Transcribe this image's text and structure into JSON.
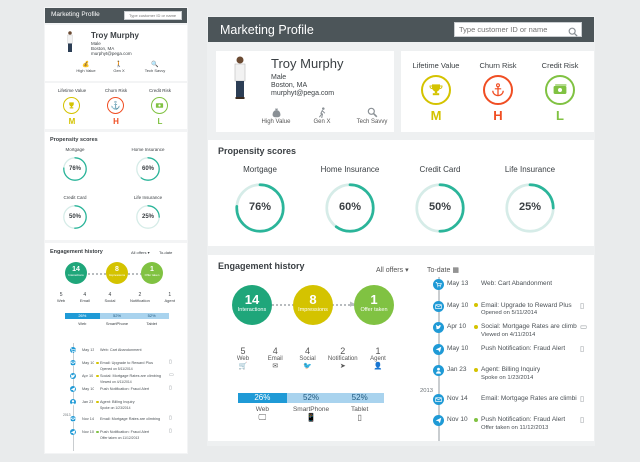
{
  "app": {
    "title": "Marketing Profile",
    "search_placeholder": "Type customer ID or name",
    "search_placeholder_small": "Type customer ID or name"
  },
  "customer": {
    "name": "Troy Murphy",
    "gender": "Male",
    "city": "Boston, MA",
    "email": "murphyt@pega.com"
  },
  "traits": [
    {
      "label": "High Value",
      "icon": "money-bag-icon"
    },
    {
      "label": "Gen X",
      "icon": "walking-person-icon"
    },
    {
      "label": "Tech Savvy",
      "icon": "magnifier-icon"
    }
  ],
  "risks": [
    {
      "label": "Lifetime Value",
      "value": "M",
      "icon": "trophy-icon",
      "color": "#d4c300"
    },
    {
      "label": "Churn Risk",
      "value": "H",
      "icon": "anchor-icon",
      "color": "#f04e23"
    },
    {
      "label": "Credit Risk",
      "value": "L",
      "icon": "cash-icon",
      "color": "#80c242"
    }
  ],
  "propensity": {
    "title": "Propensity scores",
    "items": [
      {
        "label": "Mortgage",
        "value": "76%",
        "fraction": 0.76
      },
      {
        "label": "Home Insurance",
        "value": "60%",
        "fraction": 0.6
      },
      {
        "label": "Credit Card",
        "value": "50%",
        "fraction": 0.5
      },
      {
        "label": "Life Insurance",
        "value": "25%",
        "fraction": 0.25
      }
    ]
  },
  "engagement": {
    "title": "Engagement history",
    "filter": "All offers",
    "to_date": "To-date",
    "funnel": [
      {
        "count": "14",
        "label": "Interactions",
        "color": "#1fa67a"
      },
      {
        "count": "8",
        "label": "Impressions",
        "color": "#d4c300"
      },
      {
        "count": "1",
        "label": "Offer taken",
        "color": "#80c242"
      }
    ],
    "channels": [
      {
        "count": "5",
        "label": "Web",
        "icon": "cart-icon"
      },
      {
        "count": "4",
        "label": "Email",
        "icon": "envelope-icon"
      },
      {
        "count": "4",
        "label": "Social",
        "icon": "twitter-icon"
      },
      {
        "count": "2",
        "label": "Notification",
        "icon": "paper-plane-icon"
      },
      {
        "count": "1",
        "label": "Agent",
        "icon": "person-icon"
      }
    ],
    "devices": [
      {
        "pct": "26%",
        "label": "Web",
        "fraction": 0.26,
        "icon": "monitor-icon"
      },
      {
        "pct": "52%",
        "label": "SmartPhone",
        "fraction": 0.52,
        "icon": "phone-icon"
      },
      {
        "pct": "52%",
        "label": "Tablet",
        "fraction": 0.52,
        "icon": "tablet-icon"
      }
    ],
    "timeline": [
      {
        "date": "May 13",
        "text": "Web: Cart Abandonment",
        "sub": "",
        "icon": "cart-icon",
        "status": "",
        "device": ""
      },
      {
        "date": "May 10",
        "text": "Email: Upgrade to Reward Plus",
        "sub": "Opened on 5/11/2014",
        "icon": "envelope-icon",
        "status": "#d4c300",
        "device": "phone"
      },
      {
        "date": "Apr 10",
        "text": "Social: Mortgage Rates are climbing",
        "sub": "Viewed on 4/11/2014",
        "icon": "twitter-icon",
        "status": "#d4c300",
        "device": "monitor"
      },
      {
        "date": "May 10",
        "text": "Push Notification: Fraud Alert",
        "sub": "",
        "icon": "paper-plane-icon",
        "status": "",
        "device": "phone"
      },
      {
        "date": "Jan 23",
        "text": "Agent: Billing Inquiry",
        "sub": "Spoke on 1/23/2014",
        "icon": "person-icon",
        "status": "#d4c300",
        "device": ""
      },
      {
        "date": "Nov 14",
        "text": "Email: Mortgage Rates are climbing",
        "sub": "",
        "icon": "envelope-icon",
        "status": "",
        "device": "phone"
      },
      {
        "date": "Nov 10",
        "text": "Push Notification: Fraud Alert",
        "sub": "Offer taken on 11/12/2013",
        "icon": "paper-plane-icon",
        "status": "#80c242",
        "device": "phone"
      }
    ],
    "year_label": "2013"
  }
}
